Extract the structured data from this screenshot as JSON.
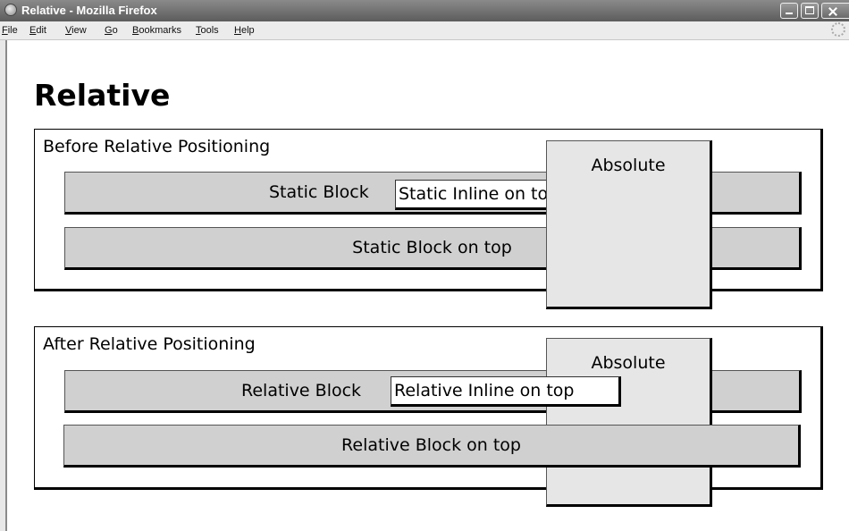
{
  "window": {
    "title": "Relative - Mozilla Firefox"
  },
  "menu": {
    "items": [
      {
        "u": "F",
        "rest": "ile"
      },
      {
        "u": "E",
        "rest": "dit"
      },
      {
        "u": "V",
        "rest": "iew"
      },
      {
        "u": "G",
        "rest": "o"
      },
      {
        "u": "B",
        "rest": "ookmarks"
      },
      {
        "u": "T",
        "rest": "ools"
      },
      {
        "u": "H",
        "rest": "elp"
      }
    ]
  },
  "page": {
    "heading": "Relative",
    "before": {
      "label": "Before Relative Positioning",
      "block_label": "Static Block",
      "inline_label": "Static Inline on top",
      "block2_label": "Static Block on top",
      "absolute_label": "Absolute"
    },
    "after": {
      "label": "After Relative Positioning",
      "block_label": "Relative Block",
      "inline_label": "Relative Inline on top",
      "block2_label": "Relative Block on top",
      "absolute_label": "Absolute"
    }
  }
}
